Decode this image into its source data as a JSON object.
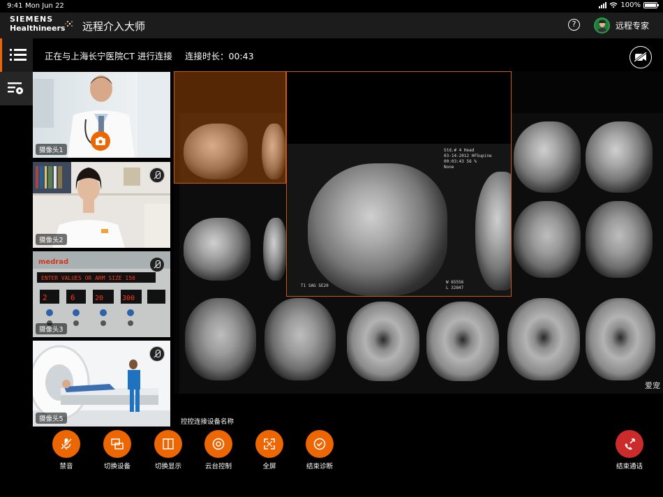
{
  "status_bar": {
    "time": "9:41",
    "date": "Mon Jun 22",
    "battery": "100%",
    "battery_level": 1.0
  },
  "header": {
    "brand_line1": "SIEMENS",
    "brand_line2": "Healthineers",
    "app_title": "远程介入大师",
    "help_icon": "help-circle-icon",
    "user_name": "远程专家"
  },
  "sidebar": {
    "items": [
      {
        "icon": "list-icon",
        "active": true
      },
      {
        "icon": "playlist-settings-icon",
        "active": false
      }
    ]
  },
  "connection": {
    "status_text": "正在与上海长宁医院CT 进行连接",
    "duration_text": "连接时长：00:43"
  },
  "cameras": [
    {
      "label": "摄像头1",
      "badge": "camera-icon"
    },
    {
      "label": "摄像头2",
      "badge": "mic-off-icon"
    },
    {
      "label": "摄像头3",
      "badge": "mic-off-icon"
    },
    {
      "label": "摄像头5",
      "badge": "mic-off-icon"
    }
  ],
  "viewer": {
    "overlay_text": {
      "zoom_lines": [
        "Std.# 4   Head",
        "03-14-2012  HFSupine",
        "00:03:43   56 %",
        "            None"
      ],
      "zoom_bottom": [
        "T1 SAG SE20",
        "W 65556",
        "L 32847"
      ]
    },
    "watermark": "爱宠"
  },
  "device_label": "控控连接设备名称",
  "toolbar": {
    "buttons": [
      {
        "label": "禁音",
        "icon": "mic-off-icon"
      },
      {
        "label": "切换设备",
        "icon": "switch-device-icon"
      },
      {
        "label": "切换显示",
        "icon": "split-view-icon"
      },
      {
        "label": "云台控制",
        "icon": "ptz-control-icon"
      },
      {
        "label": "全屏",
        "icon": "fullscreen-icon"
      },
      {
        "label": "结束诊断",
        "icon": "check-circle-icon"
      }
    ],
    "end_call_label": "结束通话"
  },
  "colors": {
    "accent": "#ec6602",
    "end_call": "#cc2b2b",
    "header_bg": "#1c1c1c"
  }
}
